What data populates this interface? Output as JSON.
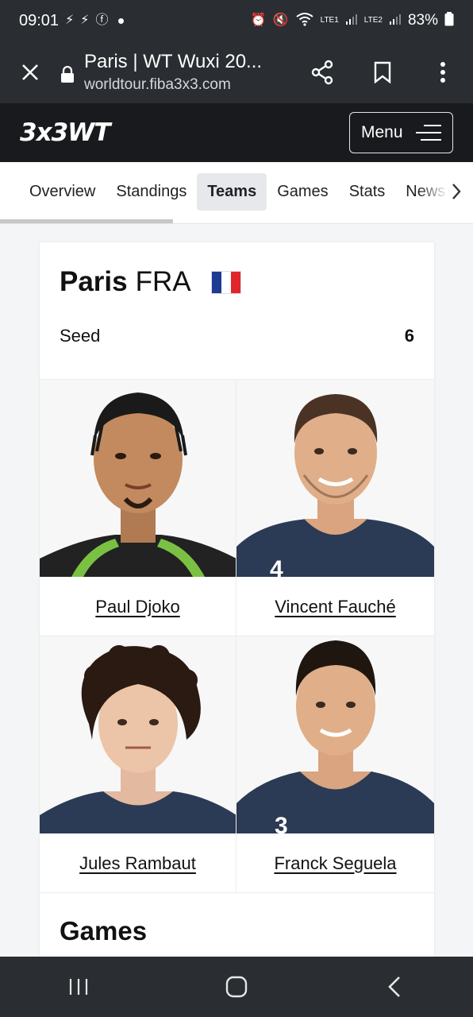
{
  "status_bar": {
    "time": "09:01",
    "network_1": "LTE1",
    "network_2": "LTE2",
    "battery": "83%"
  },
  "browser": {
    "title": "Paris | WT Wuxi 20...",
    "url": "worldtour.fiba3x3.com"
  },
  "site": {
    "logo": "3x3WT",
    "menu_label": "Menu"
  },
  "tabs": [
    {
      "label": "Overview",
      "active": false
    },
    {
      "label": "Standings",
      "active": false
    },
    {
      "label": "Teams",
      "active": true
    },
    {
      "label": "Games",
      "active": false
    },
    {
      "label": "Stats",
      "active": false
    },
    {
      "label": "News",
      "active": false
    }
  ],
  "team": {
    "name": "Paris",
    "code": "FRA",
    "seed_label": "Seed",
    "seed_value": "6",
    "flag_colors": [
      "#1f3a93",
      "#ffffff",
      "#e1252c"
    ]
  },
  "players": [
    {
      "name": "Paul Djoko",
      "jersey_color": "#222222",
      "trim_color": "#7ac143"
    },
    {
      "name": "Vincent Fauché",
      "jersey_color": "#2b3a55",
      "trim_color": "#2b3a55"
    },
    {
      "name": "Jules Rambaut",
      "jersey_color": "#2b3a55",
      "trim_color": "#2b3a55"
    },
    {
      "name": "Franck Seguela",
      "jersey_color": "#2b3a55",
      "trim_color": "#2b3a55"
    }
  ],
  "sections": {
    "games_title": "Games"
  },
  "colors": {
    "chrome_dark": "#2a2d31",
    "header_black": "#181a1d",
    "tab_active_bg": "#e6e8ec"
  }
}
